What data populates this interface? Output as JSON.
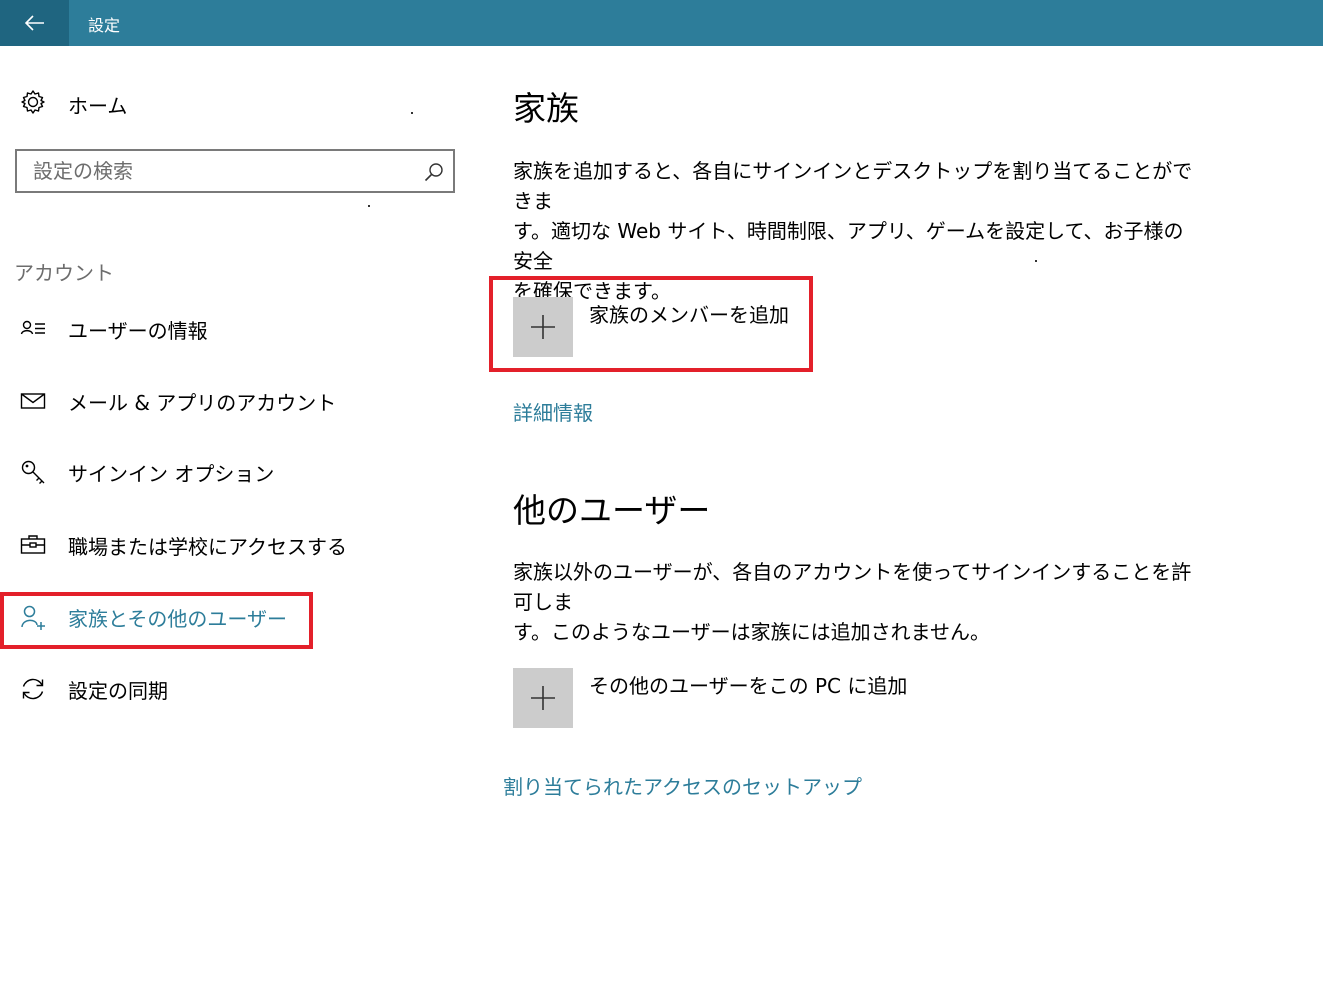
{
  "window": {
    "title": "設定",
    "back_icon": "back-arrow-icon",
    "accent": "#2d7d9a"
  },
  "sidebar": {
    "home_label": "ホーム",
    "search_placeholder": "設定の検索",
    "section_label": "アカウント",
    "items": [
      {
        "label": "ユーザーの情報",
        "icon": "user-info-icon"
      },
      {
        "label": "メール & アプリのアカウント",
        "icon": "mail-icon"
      },
      {
        "label": "サインイン オプション",
        "icon": "key-icon"
      },
      {
        "label": "職場または学校にアクセスする",
        "icon": "briefcase-icon"
      },
      {
        "label": "家族とその他のユーザー",
        "icon": "add-user-icon",
        "selected": true
      },
      {
        "label": "設定の同期",
        "icon": "sync-icon"
      }
    ]
  },
  "main": {
    "family": {
      "heading": "家族",
      "description_line1": "家族を追加すると、各自にサインインとデスクトップを割り当てることができま",
      "description_line2": "す。適切な Web サイト、時間制限、アプリ、ゲームを設定して、お子様の安全",
      "description_line3": "を確保できます。",
      "add_label": "家族のメンバーを追加",
      "more_info": "詳細情報"
    },
    "other_users": {
      "heading": "他のユーザー",
      "description_line1": "家族以外のユーザーが、各自のアカウントを使ってサインインすることを許可しま",
      "description_line2": "す。このようなユーザーは家族には追加されません。",
      "add_label": "その他のユーザーをこの PC に追加"
    },
    "assigned_access_link": "割り当てられたアクセスのセットアップ"
  },
  "annotation_color": "#e3202a"
}
